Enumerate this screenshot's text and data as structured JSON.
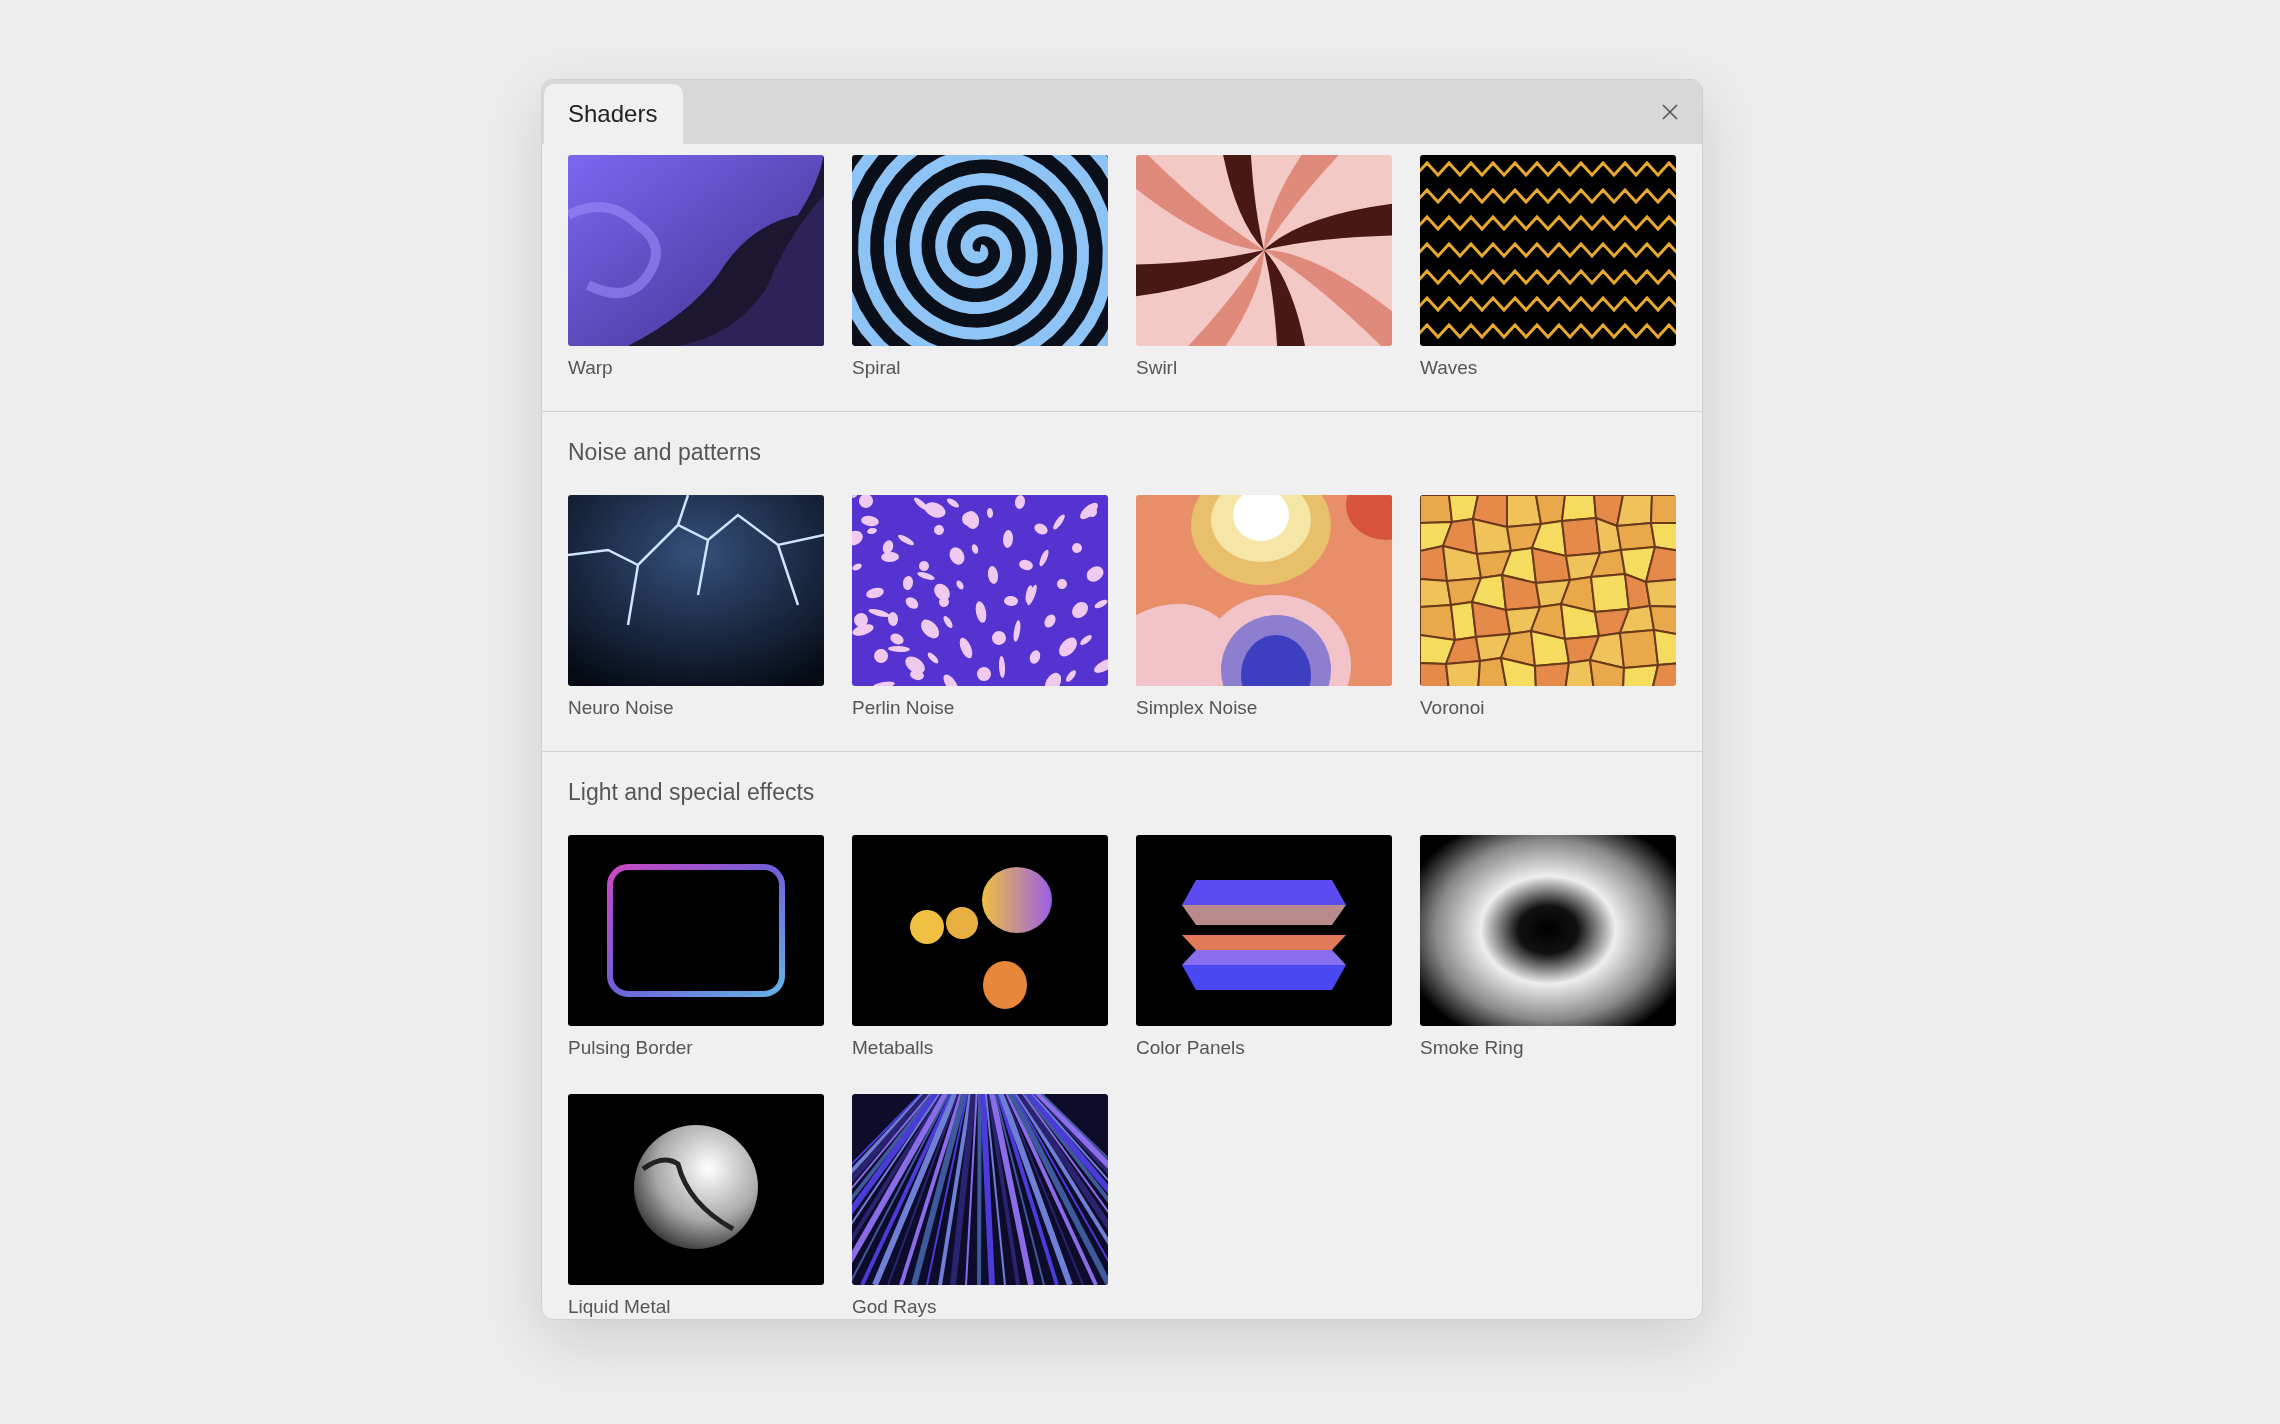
{
  "tabs": [
    {
      "label": "Shaders",
      "selected": true
    }
  ],
  "sections": [
    {
      "items": [
        {
          "label": "Warp",
          "kind": "warp"
        },
        {
          "label": "Spiral",
          "kind": "spiral"
        },
        {
          "label": "Swirl",
          "kind": "swirl"
        },
        {
          "label": "Waves",
          "kind": "waves"
        }
      ]
    },
    {
      "title": "Noise and patterns",
      "items": [
        {
          "label": "Neuro Noise",
          "kind": "neuro"
        },
        {
          "label": "Perlin Noise",
          "kind": "perlin"
        },
        {
          "label": "Simplex Noise",
          "kind": "simplex"
        },
        {
          "label": "Voronoi",
          "kind": "voronoi"
        }
      ]
    },
    {
      "title": "Light and special effects",
      "items": [
        {
          "label": "Pulsing Border",
          "kind": "border"
        },
        {
          "label": "Metaballs",
          "kind": "metaballs"
        },
        {
          "label": "Color Panels",
          "kind": "panels"
        },
        {
          "label": "Smoke Ring",
          "kind": "smoke"
        },
        {
          "label": "Liquid Metal",
          "kind": "metal"
        },
        {
          "label": "God Rays",
          "kind": "rays"
        }
      ]
    }
  ]
}
